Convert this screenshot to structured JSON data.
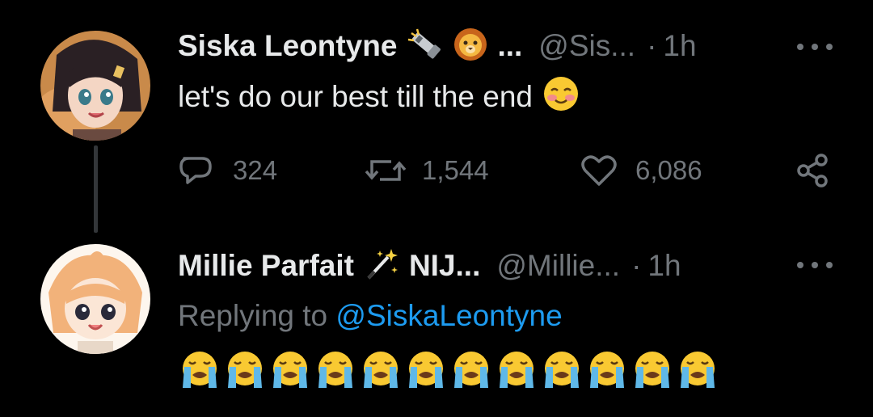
{
  "tweets": [
    {
      "display_name": "Siska Leontyne",
      "name_ellipsis": "...",
      "handle": "@Sis...",
      "separator": "·",
      "time": "1h",
      "text": "let's do our best till the end",
      "name_icons": [
        "flashlight-icon",
        "lion-face-icon"
      ],
      "text_emoji": "smiling-face-icon",
      "actions": {
        "replies": "324",
        "retweets": "1,544",
        "likes": "6,086"
      }
    },
    {
      "display_name": "Millie Parfait",
      "name_icons": [
        "magic-wand-icon"
      ],
      "name_suffix": "NIJ...",
      "handle": "@Millie...",
      "separator": "·",
      "time": "1h",
      "replying_prefix": "Replying to",
      "replying_to": "@SiskaLeontyne",
      "emoji_row": [
        "loudly-crying-face-icon",
        "loudly-crying-face-icon",
        "loudly-crying-face-icon",
        "loudly-crying-face-icon",
        "loudly-crying-face-icon",
        "loudly-crying-face-icon",
        "loudly-crying-face-icon",
        "loudly-crying-face-icon",
        "loudly-crying-face-icon",
        "loudly-crying-face-icon",
        "loudly-crying-face-icon",
        "loudly-crying-face-icon"
      ]
    }
  ],
  "colors": {
    "background": "#000000",
    "primary_text": "#e7e9ea",
    "secondary_text": "#71767b",
    "link": "#1d9bf0",
    "thread_line": "#333639"
  }
}
